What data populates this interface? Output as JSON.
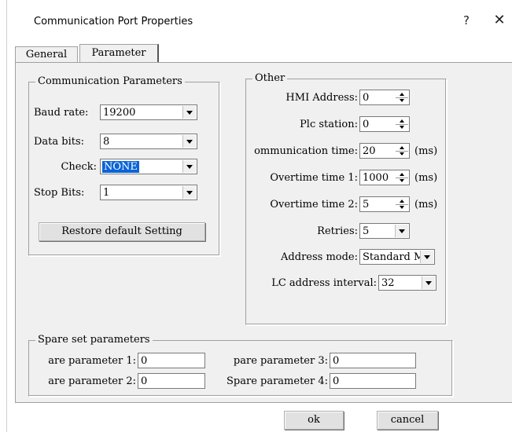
{
  "window": {
    "title": "Communication Port Properties",
    "help_glyph": "?",
    "close_glyph": "✕"
  },
  "tabs": [
    {
      "label": "General",
      "active": false
    },
    {
      "label": "Parameter",
      "active": true
    }
  ],
  "comm": {
    "group_title": "Communication Parameters",
    "baud_label": "Baud rate:",
    "baud_value": "19200",
    "databits_label": "Data bits:",
    "databits_value": "8",
    "check_label": "Check:",
    "check_value": "NONE",
    "stopbits_label": "Stop Bits:",
    "stopbits_value": "1",
    "restore_label": "Restore default Setting"
  },
  "other": {
    "group_title": "Other",
    "hmi_label": "HMI Address:",
    "hmi_value": "0",
    "plc_label": "Plc station:",
    "plc_value": "0",
    "commtime_label": "ommunication time:",
    "commtime_value": "20",
    "commtime_unit": "(ms)",
    "overtime1_label": "Overtime time 1:",
    "overtime1_value": "1000",
    "overtime1_unit": "(ms)",
    "overtime2_label": "Overtime time 2:",
    "overtime2_value": "5",
    "overtime2_unit": "(ms)",
    "retries_label": "Retries:",
    "retries_value": "5",
    "addrmode_label": "Address mode:",
    "addrmode_value": "Standard M",
    "interval_label": "LC address interval:",
    "interval_value": "32"
  },
  "spare": {
    "group_title": "Spare set parameters",
    "p1_label": "are parameter 1:",
    "p1_value": "0",
    "p2_label": "are parameter 2:",
    "p2_value": "0",
    "p3_label": "pare parameter 3:",
    "p3_value": "0",
    "p4_label": "Spare parameter 4:",
    "p4_value": "0"
  },
  "footer": {
    "ok_label": "ok",
    "cancel_label": "cancel"
  },
  "colors": {
    "selection": "#0a64d8",
    "panel_bg": "#f0f0f0"
  }
}
